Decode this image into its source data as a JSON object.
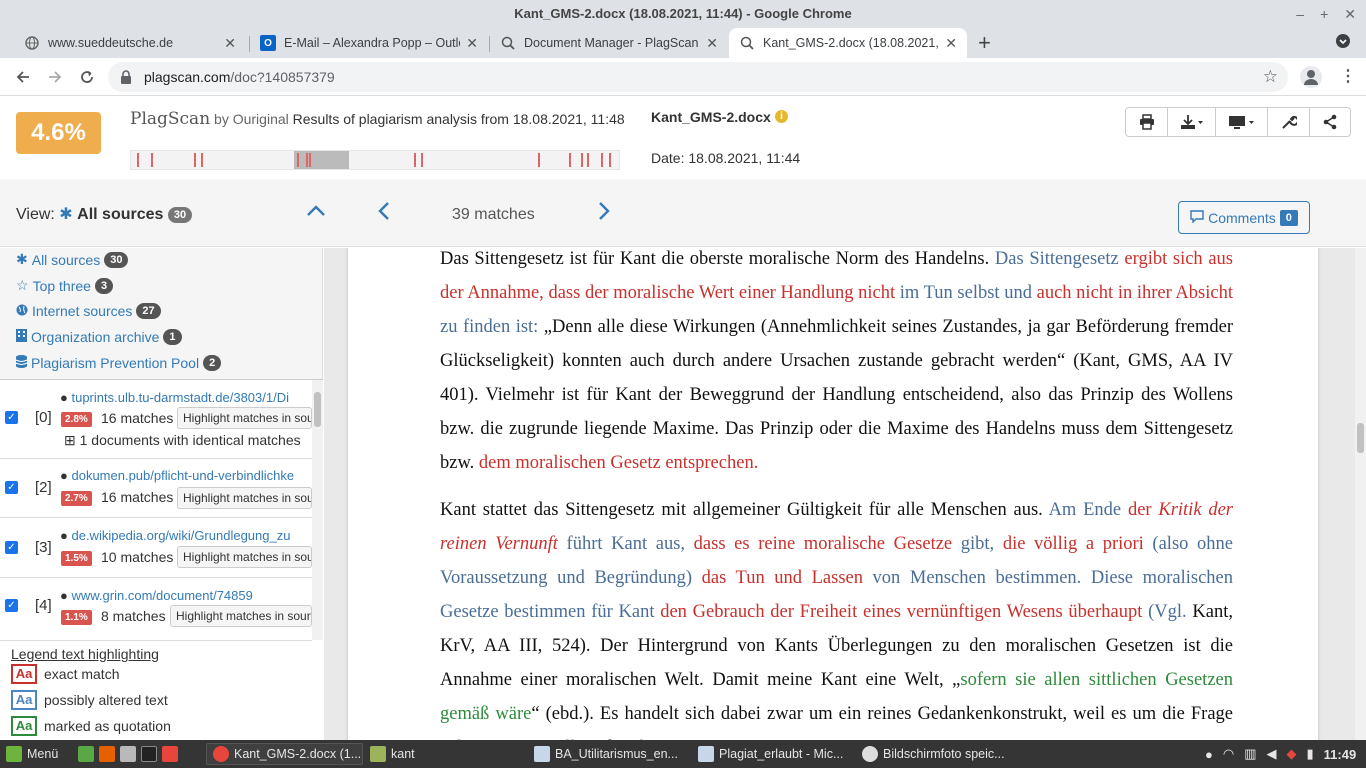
{
  "window": {
    "title": "Kant_GMS-2.docx (18.08.2021, 11:44) - Google Chrome"
  },
  "tabs": [
    {
      "label": "www.sueddeutsche.de",
      "icon": "globe-icon"
    },
    {
      "label": "E-Mail – Alexandra Popp – Outlo",
      "icon": "outlook-icon"
    },
    {
      "label": "Document Manager - PlagScan",
      "icon": "plagscan-icon"
    },
    {
      "label": "Kant_GMS-2.docx (18.08.2021,",
      "icon": "plagscan-icon"
    }
  ],
  "toolbar": {
    "url_host": "plagscan.com",
    "url_path": "/doc?140857379"
  },
  "header": {
    "score": "4.6%",
    "logo": "PlagScan",
    "logo_by": "by Ouriginal",
    "results_text": "Results of plagiarism analysis from 18.08.2021, 11:48",
    "doc_name": "Kant_GMS-2.docx",
    "doc_date": "Date: 18.08.2021, 11:44"
  },
  "viewbar": {
    "view_label": "View:",
    "view_value": "All sources",
    "view_count": "30",
    "matches": "39 matches",
    "comments_label": "Comments",
    "comments_count": "0"
  },
  "sources_nav": [
    {
      "label": "All sources",
      "count": "30",
      "icon": "asterisk-icon"
    },
    {
      "label": "Top three",
      "count": "3",
      "icon": "star-icon"
    },
    {
      "label": "Internet sources",
      "count": "27",
      "icon": "globe-icon"
    },
    {
      "label": "Organization archive",
      "count": "1",
      "icon": "building-icon"
    },
    {
      "label": "Plagiarism Prevention Pool",
      "count": "2",
      "icon": "database-icon"
    }
  ],
  "sources": [
    {
      "num": "[0]",
      "url": "tuprints.ulb.tu-darmstadt.de/3803/1/Di",
      "pct": "2.8%",
      "matches": "16 matches",
      "highlight": "Highlight matches in sou",
      "identical": "1 documents with identical matches"
    },
    {
      "num": "[2]",
      "url": "dokumen.pub/pflicht-und-verbindlichke",
      "pct": "2.7%",
      "matches": "16 matches",
      "highlight": "Highlight matches in sou"
    },
    {
      "num": "[3]",
      "url": "de.wikipedia.org/wiki/Grundlegung_zu",
      "pct": "1.5%",
      "matches": "10 matches",
      "highlight": "Highlight matches in sou"
    },
    {
      "num": "[4]",
      "url": "www.grin.com/document/74859",
      "pct": "1.1%",
      "matches": "8 matches",
      "highlight": "Highlight matches in sour"
    }
  ],
  "legend": {
    "title": "Legend text highlighting",
    "items": [
      {
        "sample": "Aa",
        "label": "exact match",
        "color": "#c9302c"
      },
      {
        "sample": "Aa",
        "label": "possibly altered text",
        "color": "#4a86c5"
      },
      {
        "sample": "Aa",
        "label": "marked as quotation",
        "color": "#2e8b3a"
      }
    ]
  },
  "document": {
    "p1": [
      {
        "t": "Das Sittengesetz ist für Kant die oberste moralische Norm des Handelns. ",
        "c": ""
      },
      {
        "t": "Das Sittengesetz ",
        "c": "al"
      },
      {
        "t": "ergibt sich aus der Annahme, dass der moralische Wert einer Handlung nicht",
        "c": "ex"
      },
      {
        "t": " im Tun selbst und ",
        "c": "al"
      },
      {
        "t": "auch nicht in ihrer Absicht",
        "c": "ex"
      },
      {
        "t": " zu finden ist:",
        "c": "al"
      },
      {
        "t": " „Denn alle diese Wirkungen (Annehmlichkeit seines Zustandes, ja gar Beförderung fremder Glückseligkeit) konnten auch durch andere Ursachen zustande gebracht werden“ (Kant, GMS, AA IV 401). Vielmehr ist für Kant der Beweggrund der Handlung entscheidend, also das Prinzip des Wollens bzw. die zugrunde liegende Maxime. Das Prinzip oder die Maxime des Handelns muss dem Sittengesetz bzw. ",
        "c": ""
      },
      {
        "t": "dem moralischen Gesetz entsprechen.",
        "c": "ex"
      }
    ],
    "p2": [
      {
        "t": "Kant stattet das Sittengesetz mit allgemeiner Gültigkeit für alle Menschen aus. ",
        "c": ""
      },
      {
        "t": "Am Ende ",
        "c": "al"
      },
      {
        "t": "der ",
        "c": "ex"
      },
      {
        "t": "Kritik der reinen Vernunft",
        "c": "exi"
      },
      {
        "t": " führt Kant aus, ",
        "c": "al"
      },
      {
        "t": "dass es reine moralische Gesetze",
        "c": "ex"
      },
      {
        "t": " gibt, ",
        "c": "al"
      },
      {
        "t": "die völlig a priori",
        "c": "ex"
      },
      {
        "t": " (also ohne Voraussetzung und Begründung) ",
        "c": "al"
      },
      {
        "t": "das Tun und Lassen",
        "c": "ex"
      },
      {
        "t": " von Menschen bestimmen. Diese moralischen Gesetze bestimmen für Kant  ",
        "c": "al"
      },
      {
        "t": "den Gebrauch der Freiheit eines vernünftigen Wesens überhaupt",
        "c": "ex"
      },
      {
        "t": " (Vgl.",
        "c": "al"
      },
      {
        "t": " Kant, KrV, AA III, 524). Der Hintergrund von Kants Überlegungen zu den moralischen Gesetzen ist die Annahme einer moralischen Welt. Damit meine Kant eine Welt, „",
        "c": ""
      },
      {
        "t": "sofern sie allen sittlichen Gesetzen gemäß wäre",
        "c": "qt"
      },
      {
        "t": "“ (ebd.). Es handelt sich dabei zwar um ein reines Gedankenkonstrukt, weil es um die Frage geht, was sein soll, und nicht was ist. Kant",
        "c": ""
      }
    ]
  },
  "taskbar": {
    "menu": "Menü",
    "items": [
      {
        "label": "Kant_GMS-2.docx (1...",
        "icon": "chrome-icon"
      },
      {
        "label": "kant",
        "icon": "folder-icon"
      },
      {
        "label": "BA_Utilitarismus_en...",
        "icon": "document-icon"
      },
      {
        "label": "Plagiat_erlaubt - Mic...",
        "icon": "word-icon"
      },
      {
        "label": "Bildschirmfoto speic...",
        "icon": "screenshot-icon"
      }
    ],
    "clock": "11:49"
  }
}
